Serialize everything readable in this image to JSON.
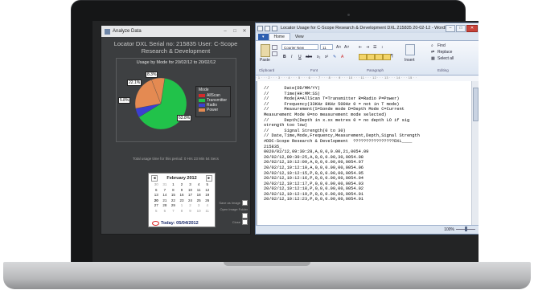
{
  "analyze": {
    "window_title": "Analyze Data",
    "header": "Locator DXL  Serial no: 215835  User: C-Scope Research & Development",
    "chart_title": "Usage by Mode for 20/02/12 to 20/02/12",
    "legend_title": "Mode",
    "total_text": "Total usage time for this period:   0 Hrs 23 Min 54 Secs",
    "save_as_image": "Save as Image",
    "open_image_folder": "Open Image Folder",
    "close": "Close"
  },
  "chart_data": {
    "type": "pie",
    "title": "Usage by Mode for 20/02/12 to 20/02/12",
    "legend_title": "Mode",
    "slices": [
      {
        "label": "AllScan",
        "value": 0,
        "color": "#d42b2b",
        "display": ""
      },
      {
        "label": "Transmitter",
        "value": 63.8,
        "color": "#21c24a",
        "display": "63.8%"
      },
      {
        "label": "Radio",
        "value": 5.8,
        "color": "#3b3fd1",
        "display": "5.8%"
      },
      {
        "label": "Power",
        "value": 22.1,
        "color": "#e48a52",
        "display": "22.1%"
      },
      {
        "label": "",
        "value": 8.3,
        "color": "#e48a52",
        "display": "8.3%"
      }
    ]
  },
  "calendar": {
    "month": "February 2012",
    "prev": "◄",
    "next": "►",
    "today": "Today: 05/04/2012",
    "days": [
      "30",
      "31",
      "1",
      "2",
      "3",
      "4",
      "5",
      "6",
      "7",
      "8",
      "9",
      "10",
      "11",
      "12",
      "13",
      "14",
      "15",
      "16",
      "17",
      "18",
      "19",
      "20",
      "21",
      "22",
      "23",
      "24",
      "25",
      "26",
      "27",
      "28",
      "29",
      "1",
      "2",
      "3",
      "4",
      "5",
      "6",
      "7",
      "8",
      "9",
      "10",
      "11"
    ]
  },
  "wordpad": {
    "title": "Locator Usage for C-Scope Research & Development DXL 215835 20-02-12 - WordPad",
    "file_tab": "▾",
    "tab_home": "Home",
    "tab_view": "View",
    "font_name": "Courier New",
    "font_size": "11",
    "group_clipboard": "Clipboard",
    "group_font": "Font",
    "group_paragraph": "Paragraph",
    "group_editing": "Editing",
    "paste": "Paste",
    "insert": "Insert",
    "find": "Find",
    "replace": "Replace",
    "select_all": "Select all",
    "zoom": "100%",
    "ruler": "· 1 · · · 2 · · · 3 · · · 4 · · · 5 · · · 6 · · · 7 · · · 8 · · · 9 · · · 10 · · · 11 · · · 12 · · · 13 · · · 14 · · · 15 · ·",
    "lines": [
      "//      Date(DD/MM/YY)",
      "//      Time(HH:MM:SS)",
      "//      Mode(A=AllScan T=Transmitter R=Radio P=Power)",
      "//      Frequency(33KHz 8KHz 500Hz 0 = not in T mode)",
      "//      Measurement(S=Sonde mode D=Depth Mode C=Current",
      "Measurement Mode 0=no measurement mode selected)",
      "//      Depth(Depth in x.xx metres 0 = no depth LO if sig",
      "strength too low)",
      "//      Signal Strength(0 to 30)",
      "// Date,Time,Mode,Frequency,Measurement,Depth,Signal Strength",
      "#DDC-Scope Research & Development  ????????????????DXL____",
      "215835_",
      "0020/02/12,09:30:28,A,0,0,0.00,21,0054.09",
      "20/02/12,09:30:25,A,0,0,0.00,30,0054.08",
      "20/02/12,10:12:09,A,0,0,0.00,00,0054.07",
      "20/02/12,10:12:10,A,0,0,0.00,00,0054.06",
      "20/02/12,10:12:15,P,0,0,0.00,00,0054.05",
      "20/02/12,10:12:16,P,0,0,0.00,00,0054.04",
      "20/02/12,10:12:17,P,0,0,0.00,00,0054.03",
      "20/02/12,10:12:18,P,0,0,0.00,00,0054.02",
      "20/02/12,10:12:19,P,0,0,0.00,00,0054.01",
      "20/02/12,10:12:23,P,0,0,0.00,00,0054.01"
    ]
  }
}
